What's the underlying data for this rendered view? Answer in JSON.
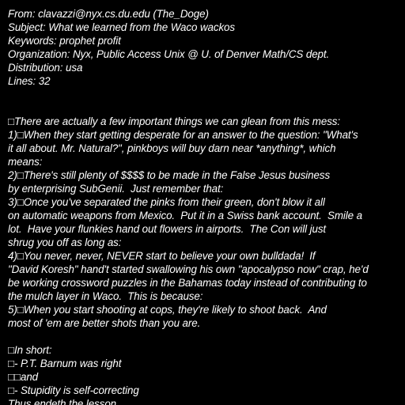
{
  "page": {
    "background": "#000000",
    "text_color": "#ffffff"
  },
  "headers": [
    "From: clavazzi@nyx.cs.du.edu (The_Doge)",
    "Subject: What we learned from the Waco wackos",
    "Keywords: prophet profit",
    "Organization: Nyx, Public Access Unix @ U. of Denver Math/CS dept.",
    "Distribution: usa",
    "Lines: 32"
  ],
  "body_lines": [
    "□There are actually a few important things we can glean from this mess:",
    "1)□When they start getting desperate for an answer to the question: \"What's",
    "it all about. Mr. Natural?\", pinkboys will buy darn near *anything*, which",
    "means:",
    "2)□There's still plenty of $$$$ to be made in the False Jesus business",
    "by enterprising SubGenii.  Just remember that:",
    "3)□Once you've separated the pinks from their green, don't blow it all",
    "on automatic weapons from Mexico.  Put it in a Swiss bank account.  Smile a",
    "lot.  Have your flunkies hand out flowers in airports.  The Con will just",
    "shrug you off as long as:",
    "4)□You never, never, NEVER start to believe your own bulldada!  If",
    "\"David Koresh\" hand't started swallowing his own \"apocalypso now\" crap, he'd",
    "be working crossword puzzles in the Bahamas today instead of contributing to",
    "the mulch layer in Waco.  This is because:",
    "5)□When you start shooting at cops, they're likely to shoot back.  And",
    "most of 'em are better shots than you are.",
    "",
    "□In short:",
    "□- P.T. Barnum was right",
    "□□and",
    "□- Stupidity is self-correcting",
    "Thus endeth the lesson."
  ]
}
